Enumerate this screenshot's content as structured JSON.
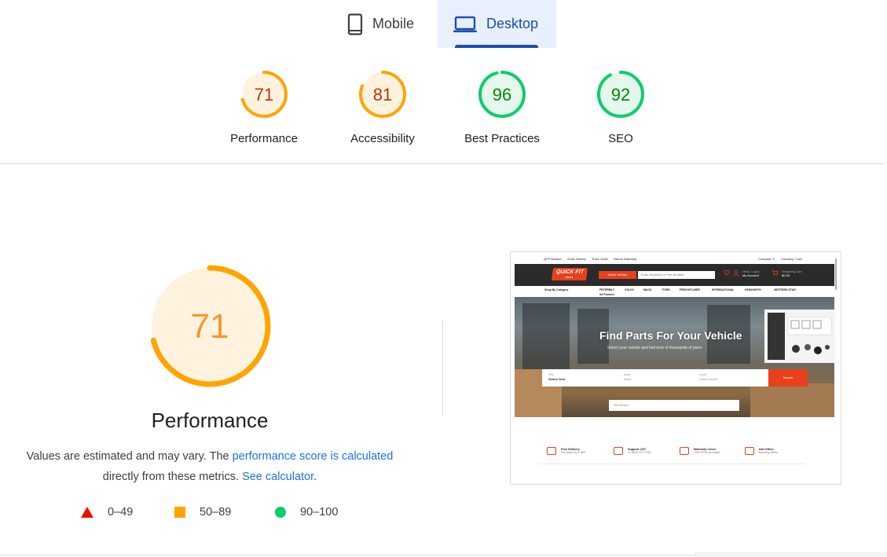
{
  "tabs": [
    {
      "label": "Mobile",
      "icon": "mobile-phone-icon",
      "active": false
    },
    {
      "label": "Desktop",
      "icon": "laptop-icon",
      "active": true
    }
  ],
  "categories": [
    {
      "score": "71",
      "label": "Performance",
      "fraction": 0.71,
      "rating": "average"
    },
    {
      "score": "81",
      "label": "Accessibility",
      "fraction": 0.81,
      "rating": "average"
    },
    {
      "score": "96",
      "label": "Best Practices",
      "fraction": 0.96,
      "rating": "pass"
    },
    {
      "score": "92",
      "label": "SEO",
      "fraction": 0.92,
      "rating": "pass"
    }
  ],
  "colors": {
    "fail": "#eb0f00",
    "average": "#ffa400",
    "average_text": "#c33300",
    "average_bg": "#fff3e0",
    "pass": "#0cce6b",
    "pass_text": "#008800",
    "pass_bg": "#e6f8ee",
    "link": "#1a73e8",
    "tab_active": "#1a4fb4"
  },
  "performance": {
    "score": "71",
    "fraction": 0.71,
    "title": "Performance",
    "desc_prefix": "Values are estimated and may vary. The ",
    "desc_link1": "performance score is calculated",
    "desc_middle": " directly from these metrics. ",
    "desc_link2": "See calculator",
    "desc_suffix": "."
  },
  "legend": [
    {
      "shape": "triangle",
      "range": "0–49"
    },
    {
      "shape": "square",
      "range": "50–89"
    },
    {
      "shape": "circle",
      "range": "90–100"
    }
  ],
  "screenshot": {
    "top_links": [
      "QFP Booklet",
      "Order History",
      "Track Order",
      "Return Warranty"
    ],
    "compare": "Compare: 0",
    "currency": "Currency: CAD",
    "logo_text": "QUICK FIT",
    "logo_sub": "PARTS",
    "select_vehicle": "Select Vehicle",
    "search_placeholder": "Enter Keyword or Part Number",
    "account_small": "Hello, Log In",
    "account": "My Account",
    "cart_small": "Shopping Cart",
    "cart_amount": "$0.00",
    "shop_by_category": "Shop By Category",
    "nav_items": [
      "PETERBILT",
      "VOLVO",
      "MACK",
      "FORD",
      "FREIGHTLINER",
      "INTERNATIONAL",
      "KENWORTH",
      "WESTERN STAR"
    ],
    "all_product": "All Product",
    "hero_title": "Find Parts For Your Vehicle",
    "hero_sub": "Select your vehicle and find tens of thousands of parts",
    "year_label": "Year",
    "year_value": "Select Year",
    "make_label": "Make",
    "make_value": "Make",
    "model_label": "Model",
    "model_value": "Select Model",
    "search_button": "Search",
    "oem_search": "OEM Search",
    "features": [
      {
        "title": "Free Delivery",
        "sub": "For orders from $50"
      },
      {
        "title": "Support 24/7",
        "sub": "+1 (800) 237-7756"
      },
      {
        "title": "Warranty Cover",
        "sub": "100% RISK Accepted"
      },
      {
        "title": "Hot Offers",
        "sub": "Bundling Offers"
      }
    ]
  }
}
